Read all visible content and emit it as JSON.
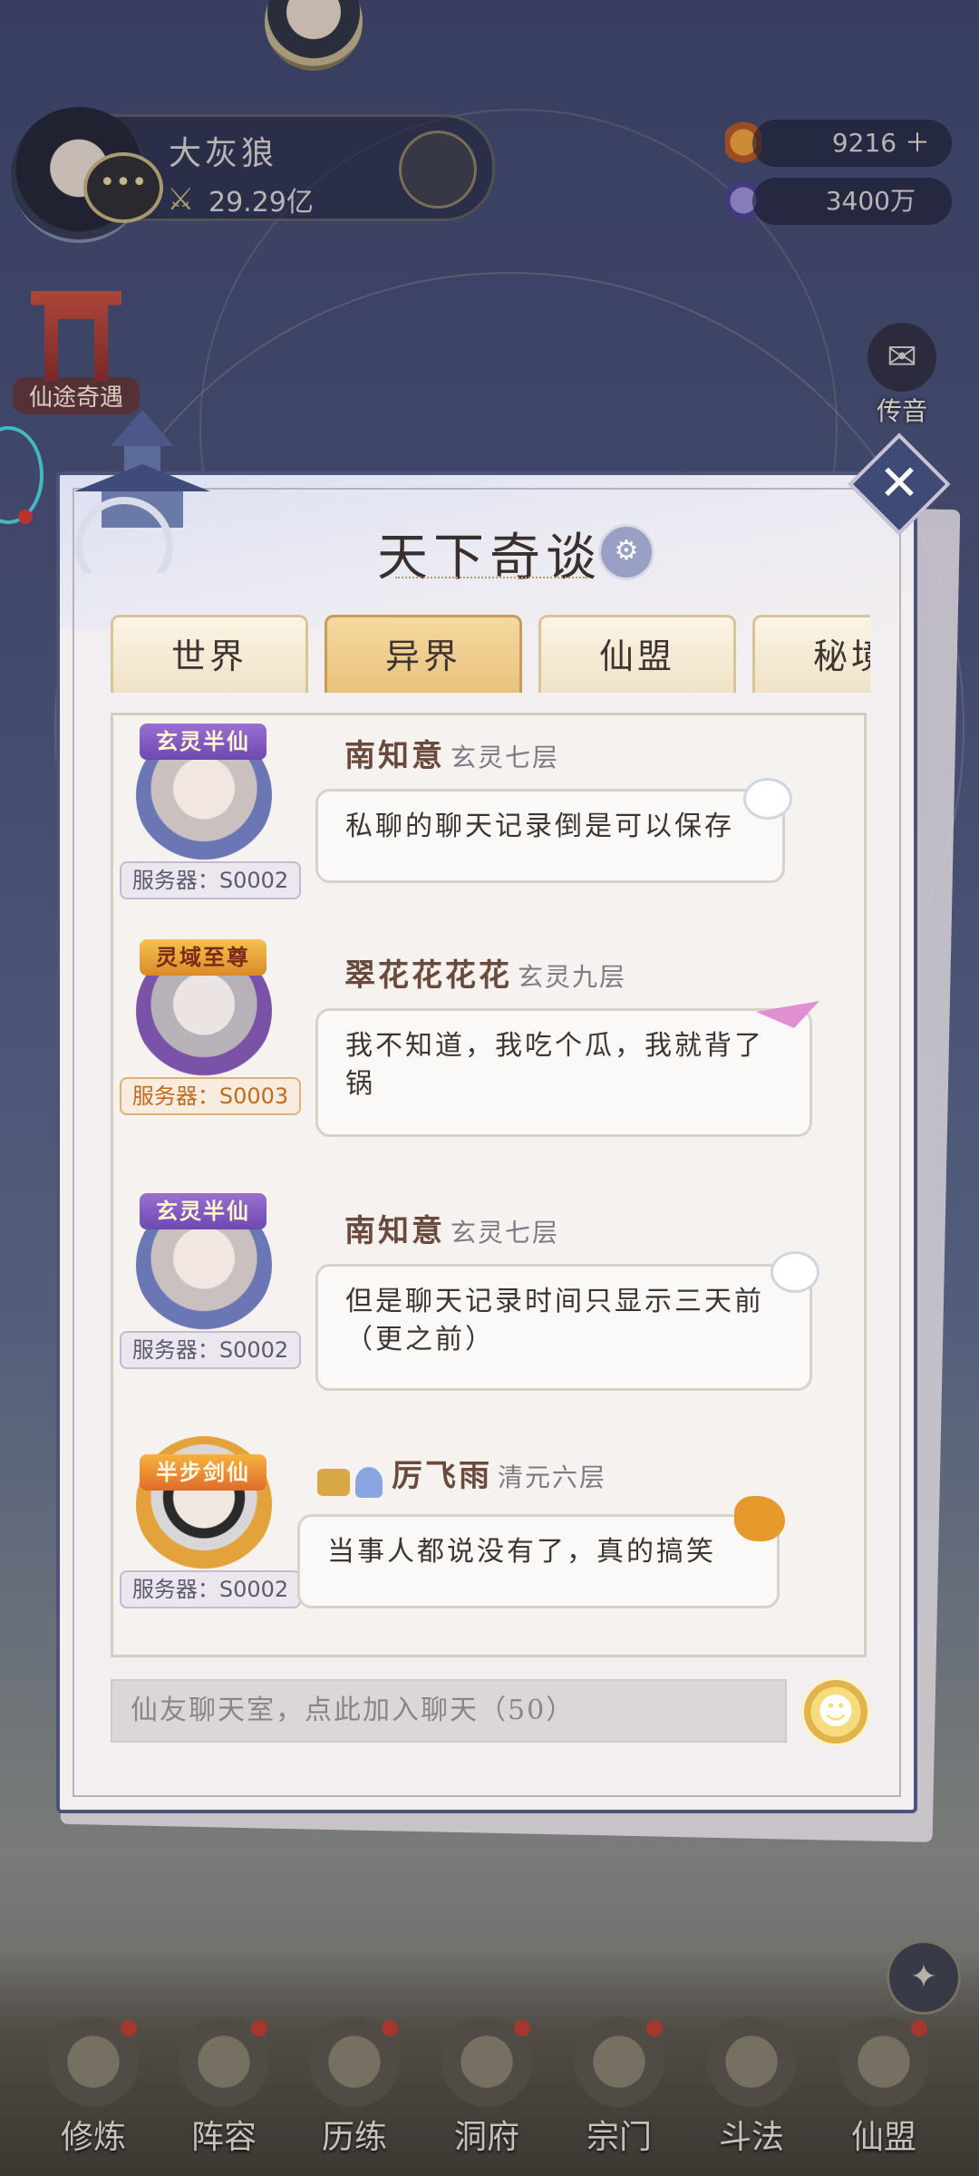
{
  "player": {
    "name": "大灰狼",
    "power": "29.29亿"
  },
  "currencies": [
    {
      "icon": "flame-gem-icon",
      "value": "9216"
    },
    {
      "icon": "spirit-stone-icon",
      "value": "3400万"
    }
  ],
  "side_left": {
    "label": "仙途奇遇"
  },
  "side_right": {
    "label": "传音"
  },
  "dialog": {
    "title": "天下奇谈",
    "tabs": [
      "世界",
      "异界",
      "仙盟",
      "秘境"
    ],
    "active_tab": "异界",
    "messages": [
      {
        "title_badge": "玄灵半仙",
        "server": "服务器：S0002",
        "name": "南知意",
        "rank": "玄灵七层",
        "text_lines": [
          "私聊的聊天记录倒是可以保存"
        ]
      },
      {
        "title_badge": "灵域至尊",
        "server": "服务器：S0003",
        "name": "翠花花花花",
        "rank": "玄灵九层",
        "text_lines": [
          "我不知道，我吃个瓜，我就背了",
          "锅"
        ]
      },
      {
        "title_badge": "玄灵半仙",
        "server": "服务器：S0002",
        "name": "南知意",
        "rank": "玄灵七层",
        "text_lines": [
          "但是聊天记录时间只显示三天前",
          "（更之前）"
        ]
      },
      {
        "title_badge": "半步剑仙",
        "server": "服务器：S0002",
        "name": "厉飞雨",
        "rank": "清元六层",
        "text_lines": [
          "当事人都说没有了，真的搞笑"
        ]
      }
    ],
    "input_placeholder": "仙友聊天室，点此加入聊天（50）"
  },
  "bottom_nav": [
    {
      "label": "修炼",
      "icon": "cultivate-icon"
    },
    {
      "label": "阵容",
      "icon": "lineup-icon"
    },
    {
      "label": "历练",
      "icon": "training-icon"
    },
    {
      "label": "洞府",
      "icon": "cave-icon"
    },
    {
      "label": "宗门",
      "icon": "sect-icon"
    },
    {
      "label": "斗法",
      "icon": "duel-icon"
    },
    {
      "label": "仙盟",
      "icon": "alliance-icon"
    }
  ],
  "colors": {
    "dialog_border": "#4c5477",
    "active_tab": "#e9c27c",
    "notification_dot": "#c23b2b"
  }
}
